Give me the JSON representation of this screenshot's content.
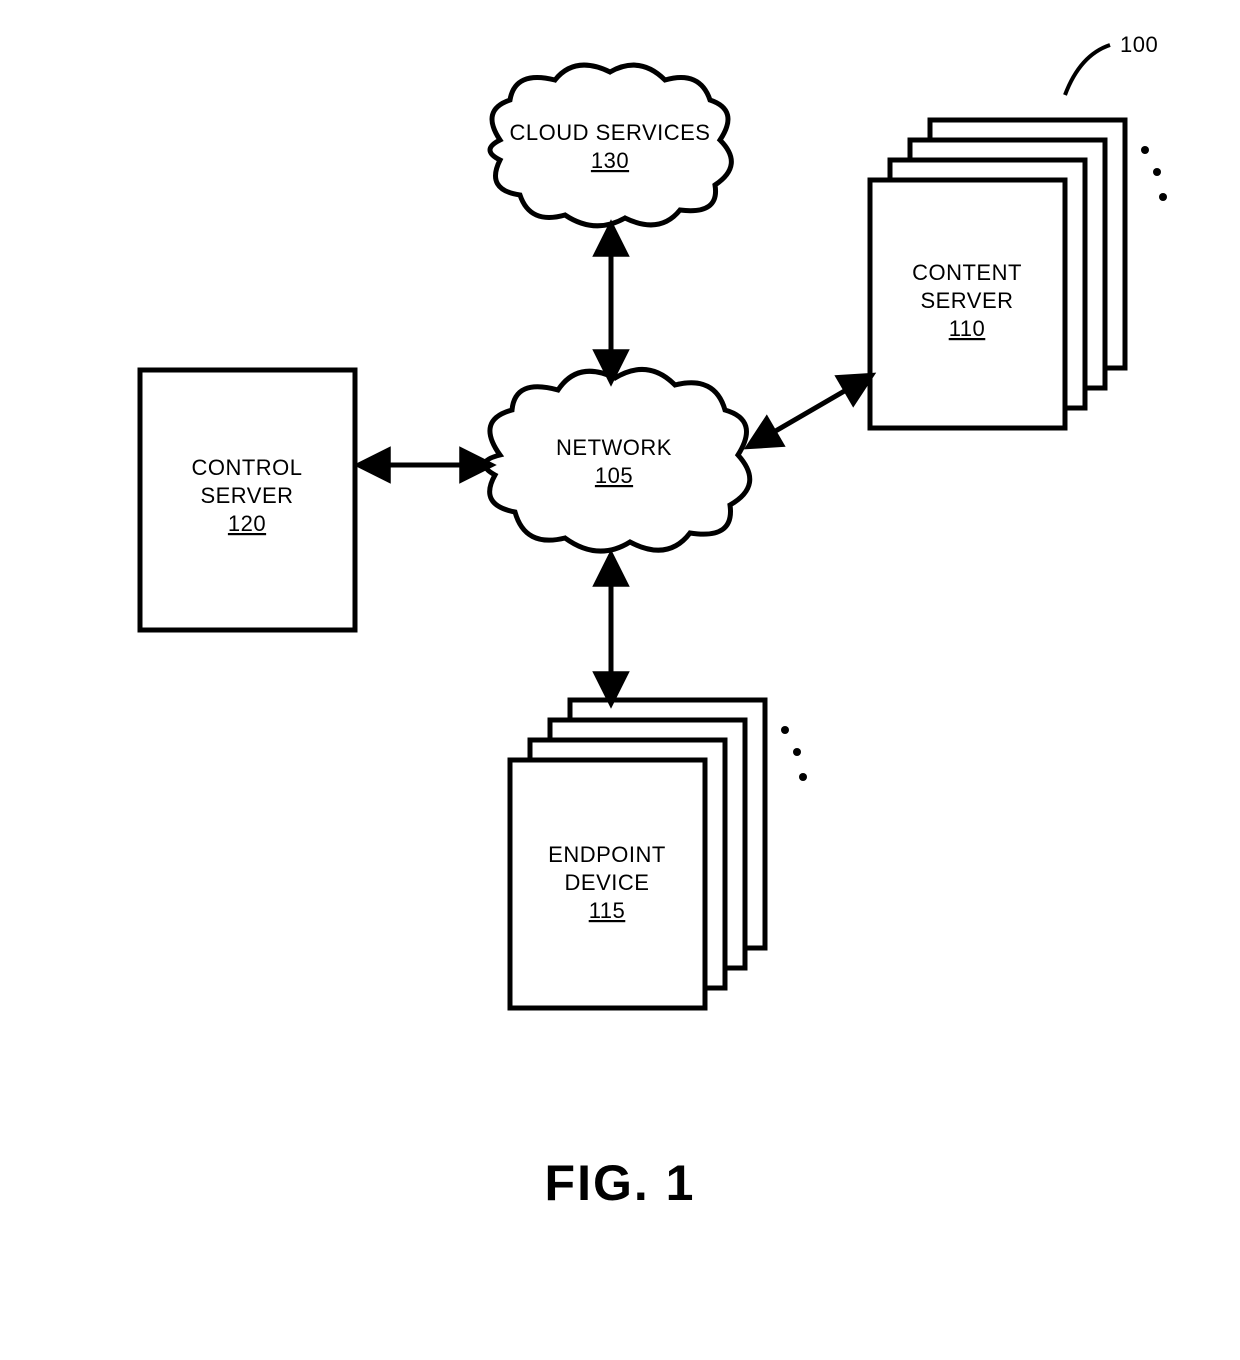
{
  "figure_ref": "100",
  "figure_caption": "FIG. 1",
  "nodes": {
    "cloud_services": {
      "label": "CLOUD SERVICES",
      "num": "130"
    },
    "network": {
      "label": "NETWORK",
      "num": "105"
    },
    "control_server": {
      "label": "CONTROL\nSERVER",
      "num": "120"
    },
    "content_server": {
      "label": "CONTENT\nSERVER",
      "num": "110"
    },
    "endpoint_device": {
      "label": "ENDPOINT\nDEVICE",
      "num": "115"
    }
  }
}
